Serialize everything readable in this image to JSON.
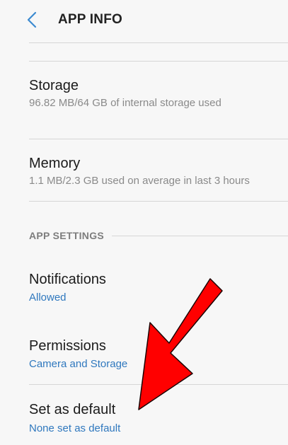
{
  "appbar": {
    "title": "APP INFO"
  },
  "rows": {
    "storage": {
      "title": "Storage",
      "subtitle": "96.82 MB/64 GB of internal storage used"
    },
    "memory": {
      "title": "Memory",
      "subtitle": "1.1 MB/2.3 GB used on average in last 3 hours"
    }
  },
  "app_settings": {
    "header": "APP SETTINGS",
    "notifications": {
      "title": "Notifications",
      "subtitle": "Allowed"
    },
    "permissions": {
      "title": "Permissions",
      "subtitle": "Camera and Storage"
    },
    "set_as_default": {
      "title": "Set as default",
      "subtitle": "None set as default"
    }
  },
  "annotation": {
    "icon": "red-arrow",
    "color": "#ff0000"
  },
  "colors": {
    "accent": "#2f78be",
    "back_icon": "#3c8ad0"
  }
}
